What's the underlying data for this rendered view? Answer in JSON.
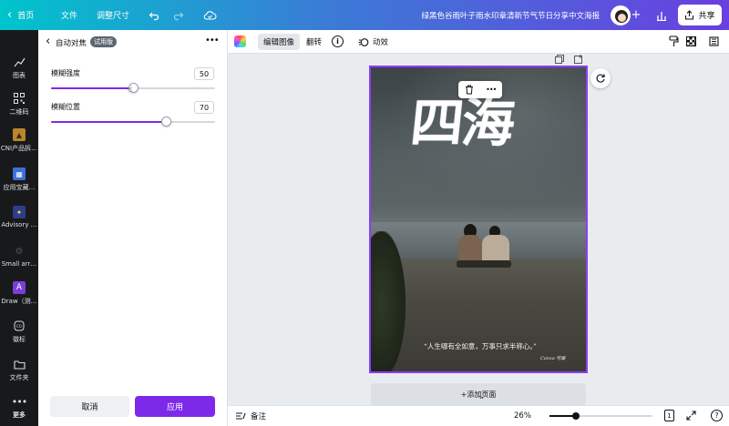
{
  "topbar": {
    "home_label": "首页",
    "file_label": "文件",
    "resize_label": "调整尺寸",
    "doc_title": "绿黑色谷雨叶子雨水印章清新节气节日分享中文海报",
    "share_label": "共享"
  },
  "rail": {
    "items": [
      {
        "label": "图表",
        "icon": "chart-icon"
      },
      {
        "label": "二维码",
        "icon": "qr-code-icon"
      },
      {
        "label": "CNI产品拆…",
        "icon": "app-icon"
      },
      {
        "label": "应用宝藏…",
        "icon": "app-icon"
      },
      {
        "label": "Advisory …",
        "icon": "app-icon"
      },
      {
        "label": "Small arr…",
        "icon": "app-icon"
      },
      {
        "label": "Draw（测…",
        "icon": "draw-icon"
      },
      {
        "label": "徽标",
        "icon": "logo-icon"
      },
      {
        "label": "文件夹",
        "icon": "folder-icon"
      },
      {
        "label": "更多",
        "icon": "more-icon"
      }
    ]
  },
  "panel": {
    "title": "自动对焦",
    "badge": "试用版",
    "sliders": [
      {
        "label": "模糊强度",
        "value": "50",
        "level": 0.5
      },
      {
        "label": "模糊位置",
        "value": "70",
        "level": 0.7
      }
    ],
    "cancel_label": "取消",
    "apply_label": "应用"
  },
  "context_toolbar": {
    "edit_image_label": "编辑图像",
    "flip_label": "翻转",
    "animate_label": "动效"
  },
  "poster": {
    "title_art": "四海",
    "quote": "“人生哪有全如意，万事只求半称心。”",
    "signature": "Canva 可画"
  },
  "canvas": {
    "add_page_label": "+添加页面"
  },
  "bottombar": {
    "notes_label": "备注",
    "zoom": "26%",
    "zoom_level": 0.26,
    "page_number": "1"
  },
  "colors": {
    "accent": "#8b3dff",
    "apply_button": "#7d2ae8",
    "rail_bg": "#18191b"
  }
}
